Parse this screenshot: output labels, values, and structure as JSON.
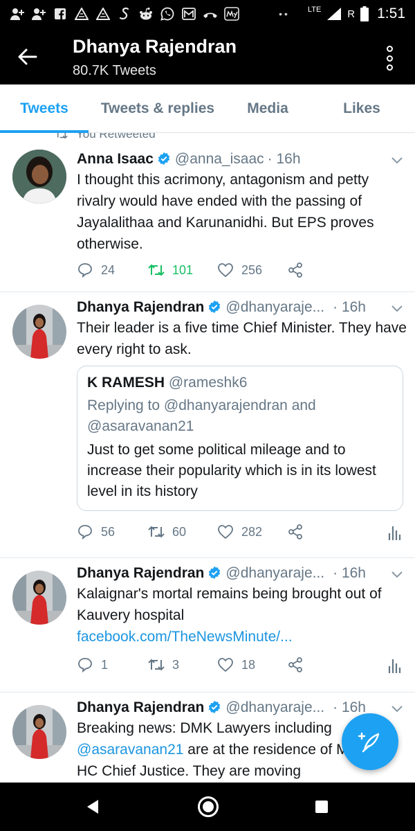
{
  "status_bar": {
    "time": "1:51",
    "network": "LTE",
    "roaming": "R",
    "icons": [
      "add-user-icon",
      "add-user-icon",
      "facebook-icon",
      "triangle-app-icon",
      "triangle-app-icon",
      "script-s-icon",
      "reddit-icon",
      "whatsapp-icon",
      "mail-icon",
      "missed-call-icon",
      "myntra-icon"
    ]
  },
  "header": {
    "name": "Dhanya Rajendran",
    "tweet_count": "80.7K Tweets"
  },
  "tabs": [
    {
      "label": "Tweets",
      "active": true
    },
    {
      "label": "Tweets & replies",
      "active": false
    },
    {
      "label": "Media",
      "active": false
    },
    {
      "label": "Likes",
      "active": false
    }
  ],
  "retweet_note": "You Retweeted",
  "tweets": [
    {
      "name": "Anna Isaac",
      "handle": "@anna_isaac",
      "time": "· 16h",
      "text": "I thought this acrimony, antagonism and petty rivalry would have ended with the passing of Jayalalithaa and Karunanidhi. But EPS proves otherwise.",
      "replies": "24",
      "retweets": "101",
      "likes": "256",
      "retweeted": true
    },
    {
      "name": "Dhanya Rajendran",
      "handle": "@dhanyaraje...",
      "time": "· 16h",
      "text": "Their leader is a five time Chief Minister. They have every right to ask.",
      "quote": {
        "name": "K RAMESH",
        "handle": "@rameshk6",
        "reply_prefix": "Replying to",
        "reply_to_1": "@dhanyarajendran",
        "reply_and": "and",
        "reply_to_2": "@asaravanan21",
        "text": "Just to get some political mileage and to increase their popularity which is in its lowest level in its history"
      },
      "replies": "56",
      "retweets": "60",
      "likes": "282"
    },
    {
      "name": "Dhanya Rajendran",
      "handle": "@dhanyaraje...",
      "time": "· 16h",
      "text": "Kalaignar's mortal remains being brought out of Kauvery hospital",
      "link": "facebook.com/TheNewsMinute/...",
      "replies": "1",
      "retweets": "3",
      "likes": "18"
    },
    {
      "name": "Dhanya Rajendran",
      "handle": "@dhanyaraje...",
      "time": "· 16h",
      "text_1": "Breaking news: DMK Lawyers including",
      "mention": "@asaravanan21",
      "text_2": "are at the residence of Madras HC Chief Justice. They are moving"
    }
  ],
  "colors": {
    "accent": "#1da1f2",
    "retweet_green": "#17bf63",
    "muted": "#657786"
  }
}
